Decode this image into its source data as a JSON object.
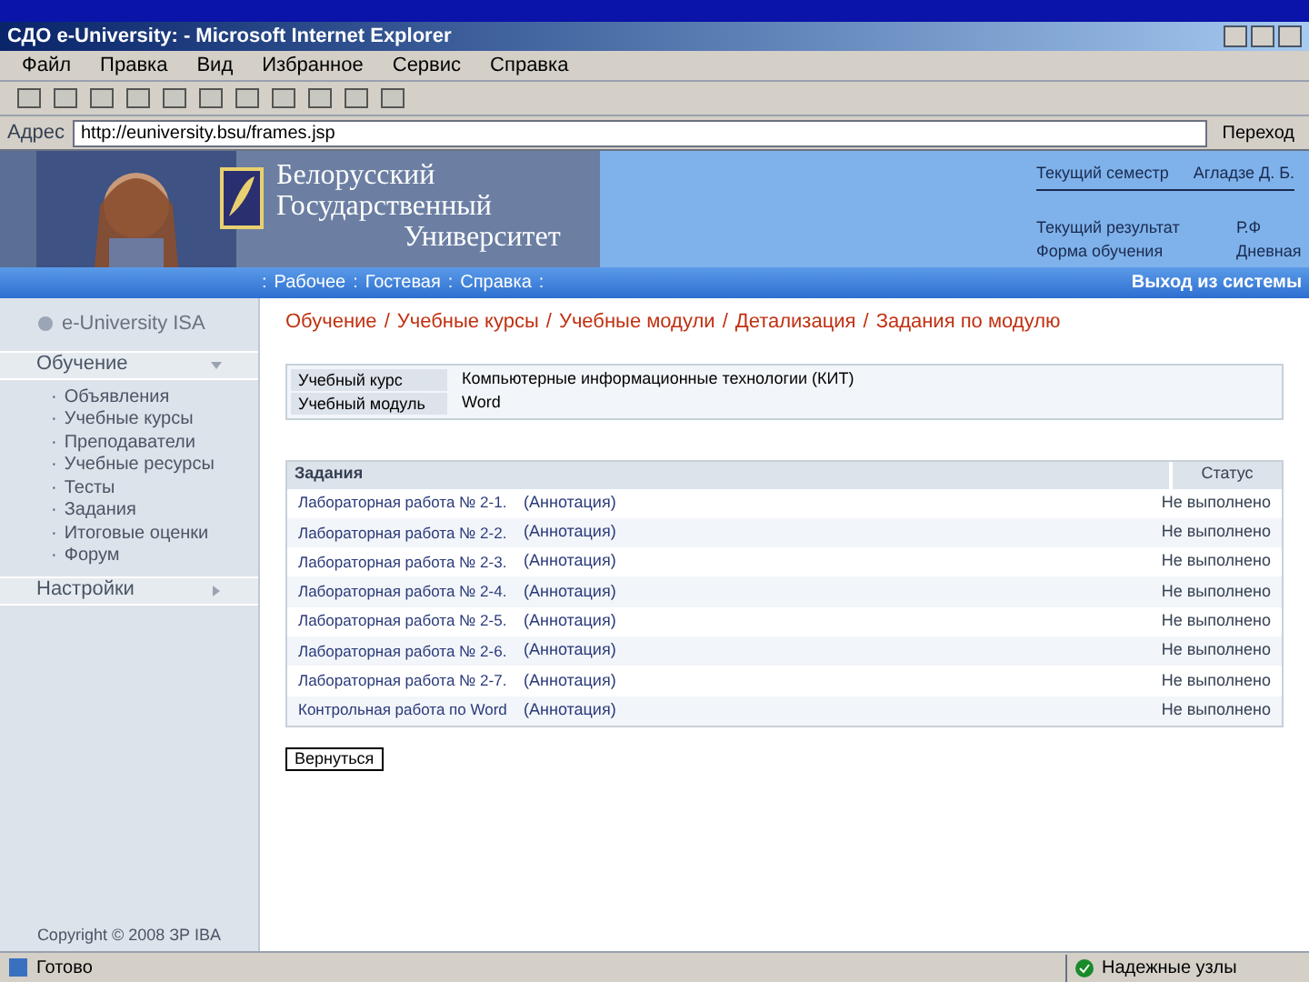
{
  "window": {
    "title": "СДО e-University: - Microsoft Internet Explorer"
  },
  "menu": [
    "Файл",
    "Правка",
    "Вид",
    "Избранное",
    "Сервис",
    "Справка"
  ],
  "address": {
    "label": "Адрес",
    "value": "http://euniversity.bsu/frames.jsp",
    "go": "Переход"
  },
  "header": {
    "university": [
      "Белорусский",
      "Государственный",
      "Университет"
    ],
    "info": [
      {
        "label": "Текущий семестр",
        "value": "Агладзе Д. Б."
      },
      {
        "label": "Текущий результат",
        "value": "Р.Ф"
      },
      {
        "label": "Форма обучения",
        "value": "Дневная"
      }
    ]
  },
  "nav": {
    "separator": ":",
    "links": [
      "Рабочее",
      "Гостевая",
      "Справка"
    ],
    "logout": "Выход из системы"
  },
  "sidebar": {
    "logo": "e-University ISA",
    "bullet": "·",
    "sections": [
      {
        "label": "Обучение",
        "expanded": true,
        "items": [
          "Объявления",
          "Учебные курсы",
          "Преподаватели",
          "Учебные ресурсы",
          "Тесты",
          "Задания",
          "Итоговые оценки",
          "Форум"
        ]
      },
      {
        "label": "Настройки",
        "expanded": false
      }
    ],
    "copyright": "Copyright © 2008 ЗР IBA"
  },
  "breadcrumb_separator": "/",
  "breadcrumb": [
    "Обучение",
    "Учебные курсы",
    "Учебные модули",
    "Детализация",
    "Задания по модулю"
  ],
  "info": [
    {
      "label": "Учебный курс",
      "value": "Компьютерные информационные технологии (КИТ)"
    },
    {
      "label": "Учебный модуль",
      "value": "Word"
    }
  ],
  "table": {
    "columns": [
      "Задания",
      "Статус"
    ],
    "rows": [
      {
        "task": "Лабораторная работа № 2-1.",
        "note": "(Аннотация)",
        "status": "Не выполнено"
      },
      {
        "task": "Лабораторная работа № 2-2.",
        "note": "(Аннотация)",
        "status": "Не выполнено"
      },
      {
        "task": "Лабораторная работа № 2-3.",
        "note": "(Аннотация)",
        "status": "Не выполнено"
      },
      {
        "task": "Лабораторная работа № 2-4.",
        "note": "(Аннотация)",
        "status": "Не выполнено"
      },
      {
        "task": "Лабораторная работа № 2-5.",
        "note": "(Аннотация)",
        "status": "Не выполнено"
      },
      {
        "task": "Лабораторная работа № 2-6.",
        "note": "(Аннотация)",
        "status": "Не выполнено"
      },
      {
        "task": "Лабораторная работа № 2-7.",
        "note": "(Аннотация)",
        "status": "Не выполнено"
      },
      {
        "task": "Контрольная работа по Word",
        "note": "(Аннотация)",
        "status": "Не выполнено"
      }
    ]
  },
  "back_button": "Вернуться",
  "status_bar": {
    "left": "Готово",
    "zone": "Надежные узлы"
  }
}
